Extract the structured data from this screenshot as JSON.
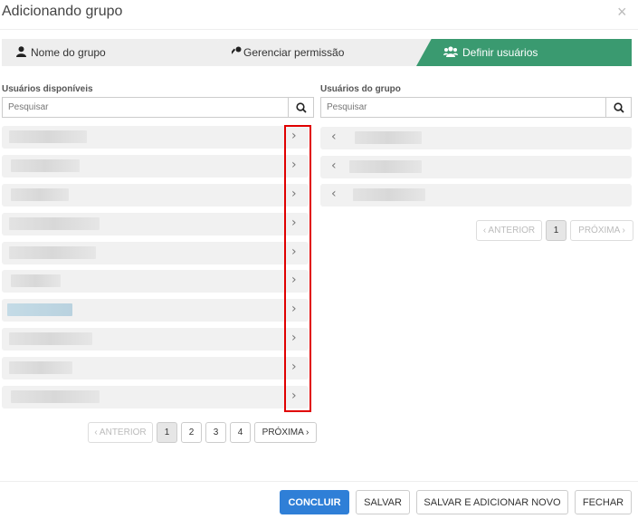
{
  "dialog": {
    "title": "Adicionando grupo",
    "close_icon": "×"
  },
  "steps": [
    {
      "icon": "user-icon",
      "label": "Nome do grupo",
      "active": false
    },
    {
      "icon": "key-icon",
      "label": "Gerenciar permissão",
      "active": false
    },
    {
      "icon": "users-icon",
      "label": "Definir usuários",
      "active": true
    }
  ],
  "colors": {
    "active_step": "#3a9a70",
    "primary_button": "#2f7fd7",
    "highlight_box": "#e00000"
  },
  "available": {
    "label": "Usuários disponíveis",
    "search_placeholder": "Pesquisar",
    "rows_count_visible": 10,
    "pager": {
      "prev": "‹ ANTERIOR",
      "pages": [
        "1",
        "2",
        "3",
        "4"
      ],
      "current": "1",
      "next": "PRÓXIMA ›"
    }
  },
  "group": {
    "label": "Usuários do grupo",
    "search_placeholder": "Pesquisar",
    "rows_count_visible": 3,
    "pager": {
      "prev": "‹ ANTERIOR",
      "pages": [
        "1"
      ],
      "current": "1",
      "next": "PRÓXIMA ›"
    }
  },
  "footer": {
    "conclude": "CONCLUIR",
    "save": "SALVAR",
    "save_add_new": "SALVAR E ADICIONAR NOVO",
    "close": "FECHAR"
  }
}
